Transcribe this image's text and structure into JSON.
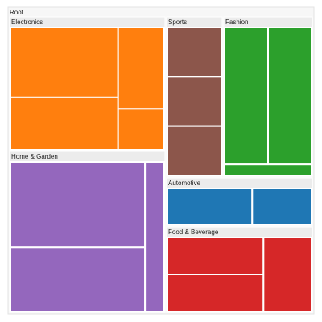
{
  "chart_data": {
    "type": "treemap",
    "title": "",
    "root": {
      "label": "Root"
    },
    "groups": [
      {
        "name": "Electronics",
        "color": "#ff7f0e",
        "values": [
          3,
          1.5,
          0.75,
          2.25
        ]
      },
      {
        "name": "Home & Garden",
        "color": "#9467bd",
        "values": [
          4,
          3,
          1
        ]
      },
      {
        "name": "Sports",
        "color": "#8c564b",
        "values": [
          1,
          1,
          1
        ]
      },
      {
        "name": "Fashion",
        "color": "#2ca02c",
        "values": [
          1.85,
          1.85,
          0.3
        ]
      },
      {
        "name": "Automotive",
        "color": "#1f77b4",
        "values": [
          1,
          0.7
        ]
      },
      {
        "name": "Food & Beverage",
        "color": "#d62728",
        "values": [
          1,
          1,
          1
        ]
      }
    ]
  }
}
